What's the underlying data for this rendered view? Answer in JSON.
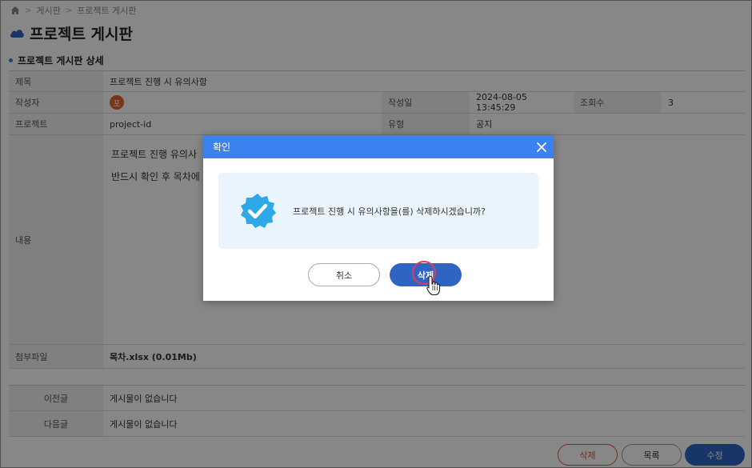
{
  "breadcrumb": {
    "items": [
      "게시판",
      "프로젝트 게시판"
    ],
    "home_icon": "home-icon"
  },
  "page": {
    "title": "프로젝트 게시판",
    "title_icon": "cloud-icon"
  },
  "section": {
    "title": "프로젝트 게시판 상세"
  },
  "detail": {
    "title_label": "제목",
    "title_value": "프로젝트 진행 시 유의사항",
    "author_label": "작성자",
    "author_avatar": "포",
    "date_label": "작성일",
    "date_value": "2024-08-05 13:45:29",
    "views_label": "조회수",
    "views_value": "3",
    "project_label": "프로젝트",
    "project_value": "project-id",
    "type_label": "유형",
    "type_value": "공지",
    "content_label": "내용",
    "content_lines": [
      "프로젝트 진행 유의사",
      "반드시 확인 후 목차에"
    ],
    "attachment_label": "첨부파일",
    "attachment_value": "목차.xlsx (0.01Mb)"
  },
  "nav": {
    "prev_label": "이전글",
    "prev_value": "게시물이 없습니다",
    "next_label": "다음글",
    "next_value": "게시물이 없습니다"
  },
  "buttons": {
    "delete": "삭제",
    "list": "목록",
    "edit": "수정"
  },
  "modal": {
    "title": "확인",
    "message": "프로젝트 진행 시 유의사항을(를) 삭제하시겠습니까?",
    "cancel": "취소",
    "confirm": "삭제",
    "icon": "verified-badge-icon"
  },
  "colors": {
    "header_blue": "#3b82f0",
    "primary_button": "#2f64c3",
    "danger": "#d95b3a",
    "badge_blue": "#2ea8e8",
    "avatar": "#e0662c"
  }
}
